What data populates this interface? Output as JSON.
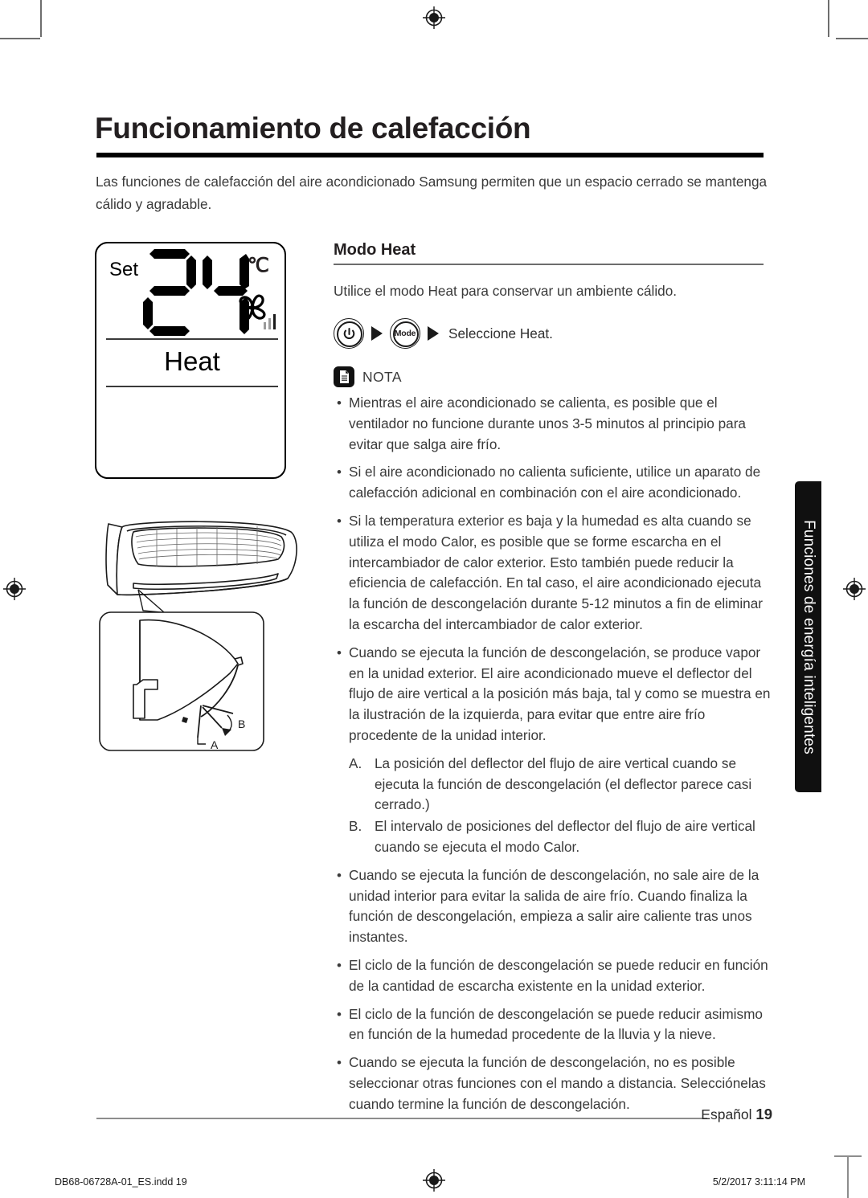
{
  "page": {
    "title": "Funcionamiento de calefacción",
    "intro": "Las funciones de calefacción del aire acondicionado Samsung permiten que un espacio cerrado se mantenga cálido y agradable.",
    "side_tab": "Funciones de energía inteligentes",
    "footer_language": "Español",
    "footer_page_number": "19",
    "print_file": "DB68-06728A-01_ES.indd   19",
    "print_timestamp": "5/2/2017   3:11:14 PM"
  },
  "display": {
    "set_label": "Set",
    "temperature": "24",
    "unit": "℃",
    "mode": "Heat",
    "fan_icon": "fan-icon",
    "signal_bars": 3
  },
  "illustration": {
    "label_a": "A",
    "label_b": "B",
    "caption": "unidad interior con detalle del deflector de flujo de aire vertical"
  },
  "section": {
    "heading": "Modo Heat",
    "intro": "Utilice el modo Heat para conservar un ambiente cálido.",
    "steps": {
      "power_icon": "power-icon",
      "mode_button": "Mode",
      "arrow": "▶",
      "result": "Seleccione Heat."
    },
    "note_label": "NOTA",
    "note_icon": "note-document-icon",
    "bullet_marker": "•",
    "notes": [
      "Mientras el aire acondicionado se calienta, es posible que el ventilador no funcione durante unos 3-5 minutos al principio para evitar que salga aire frío.",
      "Si el aire acondicionado no calienta suficiente, utilice un aparato de calefacción adicional en combinación con el aire acondicionado.",
      "Si la temperatura exterior es baja y la humedad es alta cuando se utiliza el modo Calor, es posible que se forme escarcha en el intercambiador de calor exterior. Esto también puede reducir la eficiencia de calefacción. En tal caso, el aire acondicionado ejecuta la función de descongelación durante 5-12 minutos a fin de eliminar la escarcha del intercambiador de calor exterior.",
      "Cuando se ejecuta la función de descongelación, se produce vapor en la unidad exterior. El aire acondicionado mueve el deflector del flujo de aire vertical a la posición más baja, tal y como se muestra en la ilustración de la izquierda, para evitar que entre aire frío procedente de la unidad interior.",
      "Cuando se ejecuta la función de descongelación, no sale aire de la unidad interior para evitar la salida de aire frío. Cuando finaliza la función de descongelación, empieza a salir aire caliente tras unos instantes.",
      "El ciclo de la función de descongelación se puede reducir en función de la cantidad de escarcha existente en la unidad exterior.",
      "El ciclo de la función de descongelación se puede reducir asimismo en función de la humedad procedente de la lluvia y la nieve.",
      "Cuando se ejecuta la función de descongelación, no es posible seleccionar otras funciones con el mando a distancia. Selecciónelas cuando termine la función de descongelación."
    ],
    "sub_items": [
      {
        "mark": "A.",
        "text": "La posición del deflector del flujo de aire vertical cuando se ejecuta la función de descongelación (el deflector parece casi cerrado.)"
      },
      {
        "mark": "B.",
        "text": "El intervalo de posiciones del deflector del flujo de aire vertical cuando se ejecuta el modo Calor."
      }
    ]
  },
  "colors": {
    "ink": "#231f20",
    "body_text": "#3a3a3a",
    "rule": "#6d6d6d",
    "tab_background": "#101010",
    "tab_text": "#ffffff"
  }
}
